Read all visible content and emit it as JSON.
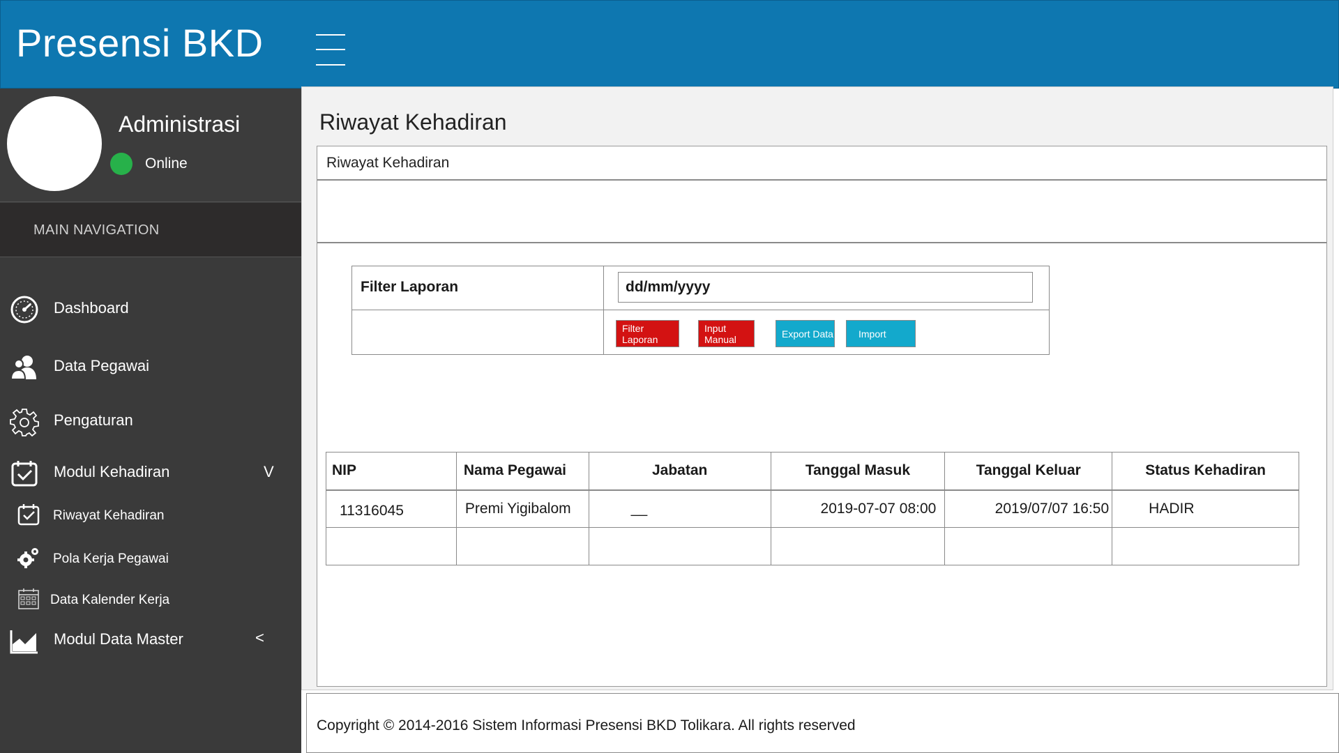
{
  "header": {
    "brand": "Presensi BKD"
  },
  "user": {
    "name": "Administrasi",
    "status": "Online",
    "status_color": "#27b14a"
  },
  "nav": {
    "header": "MAIN NAVIGATION",
    "items": [
      {
        "label": "Dashboard",
        "icon": "dashboard-gauge-icon"
      },
      {
        "label": "Data Pegawai",
        "icon": "users-icon"
      },
      {
        "label": "Pengaturan",
        "icon": "gear-icon"
      },
      {
        "label": "Modul Kehadiran",
        "icon": "calendar-check-icon",
        "caret": "V"
      },
      {
        "label": "Modul Data Master",
        "icon": "area-chart-icon",
        "caret": "<"
      }
    ],
    "subitems": [
      {
        "label": "Riwayat Kehadiran",
        "icon": "calendar-check-icon"
      },
      {
        "label": "Pola Kerja Pegawai",
        "icon": "gears-icon"
      },
      {
        "label": "Data Kalender Kerja",
        "icon": "calendar-grid-icon"
      }
    ]
  },
  "main": {
    "page_title": "Riwayat Kehadiran",
    "box_title": "Riwayat Kehadiran",
    "filter": {
      "label": "Filter Laporan",
      "date_value": "dd/mm/yyyy",
      "buttons": [
        "Filter Laporan",
        "Input Manual",
        "Export Data",
        "Import"
      ]
    },
    "table": {
      "columns": [
        "NIP",
        "Nama Pegawai",
        "Jabatan",
        "Tanggal Masuk",
        "Tanggal Keluar",
        "Status Kehadiran"
      ],
      "rows": [
        [
          "11316045",
          "Premi Yigibalom",
          "__",
          "2019-07-07 08:00",
          "2019/07/07 16:50",
          "HADIR"
        ],
        [
          "",
          "",
          "",
          "",
          "",
          ""
        ]
      ]
    }
  },
  "footer": {
    "text": "Copyright © 2014-2016 Sistem Informasi Presensi BKD Tolikara. All rights reserved"
  },
  "colors": {
    "header_bg": "#0e77b0",
    "sidebar_bg": "#3a3a3a",
    "btn_red": "#d31212",
    "btn_cyan": "#13a9cc"
  }
}
